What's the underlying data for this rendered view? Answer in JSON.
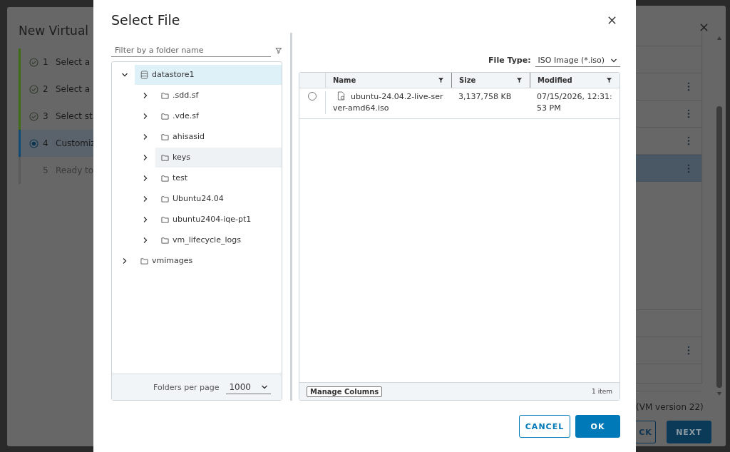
{
  "wizard": {
    "title": "New Virtual",
    "steps": [
      {
        "number": "1",
        "label": "Select a",
        "completed": true,
        "selected": false
      },
      {
        "number": "2",
        "label": "Select a",
        "completed": true,
        "selected": false
      },
      {
        "number": "3",
        "label": "Select st",
        "completed": true,
        "selected": false
      },
      {
        "number": "4",
        "label": "Customiz",
        "completed": false,
        "selected": true
      },
      {
        "number": "5",
        "label": "Ready to",
        "completed": false,
        "selected": false
      }
    ],
    "rows": [
      {
        "kind": "line",
        "menu": false,
        "selected": false
      },
      {
        "kind": "line",
        "menu": true,
        "selected": false
      },
      {
        "kind": "line",
        "menu": true,
        "selected": false
      },
      {
        "kind": "line",
        "menu": true,
        "selected": false
      },
      {
        "kind": "line",
        "menu": true,
        "selected": true
      },
      {
        "kind": "block",
        "menu": false,
        "selected": false
      },
      {
        "kind": "line",
        "menu": false,
        "selected": false
      },
      {
        "kind": "line",
        "menu": true,
        "selected": false
      },
      {
        "kind": "line",
        "menu": false,
        "selected": false
      }
    ],
    "compatibility": "(VM version 22)",
    "back_button": "CK",
    "next_button": "NEXT"
  },
  "dialog": {
    "title": "Select File",
    "filter": {
      "placeholder": "Filter by a folder name"
    },
    "tree": [
      {
        "label": "datastore1",
        "kind": "datastore",
        "expanded": true,
        "selected": true,
        "highlighted": false,
        "children": [
          {
            "label": ".sdd.sf",
            "kind": "folder",
            "expanded": false,
            "selected": false,
            "highlighted": false
          },
          {
            "label": ".vde.sf",
            "kind": "folder",
            "expanded": false,
            "selected": false,
            "highlighted": false
          },
          {
            "label": "ahisasid",
            "kind": "folder",
            "expanded": false,
            "selected": false,
            "highlighted": false
          },
          {
            "label": "keys",
            "kind": "folder",
            "expanded": false,
            "selected": false,
            "highlighted": true
          },
          {
            "label": "test",
            "kind": "folder",
            "expanded": false,
            "selected": false,
            "highlighted": false
          },
          {
            "label": "Ubuntu24.04",
            "kind": "folder",
            "expanded": false,
            "selected": false,
            "highlighted": false
          },
          {
            "label": "ubuntu2404-iqe-pt1",
            "kind": "folder",
            "expanded": false,
            "selected": false,
            "highlighted": false
          },
          {
            "label": "vm_lifecycle_logs",
            "kind": "folder",
            "expanded": false,
            "selected": false,
            "highlighted": false
          }
        ]
      },
      {
        "label": "vmimages",
        "kind": "folder",
        "expanded": false,
        "selected": false,
        "highlighted": false
      }
    ],
    "folders_per_page": {
      "label": "Folders per page",
      "value": "1000"
    },
    "file_type": {
      "label": "File Type:",
      "value": "ISO Image (*.iso)"
    },
    "table": {
      "columns": [
        "Name",
        "Size",
        "Modified"
      ],
      "rows": [
        {
          "selected": false,
          "name": "ubuntu-24.04.2-live-ser ver-amd64.iso",
          "size": "3,137,758 KB",
          "modified": "07/15/2026, 12:31: 53 PM"
        }
      ],
      "manage_columns": "Manage Columns",
      "count": "1 item"
    },
    "buttons": [
      {
        "label": "CANCEL",
        "kind": "secondary"
      },
      {
        "label": "OK",
        "kind": "primary"
      }
    ]
  }
}
